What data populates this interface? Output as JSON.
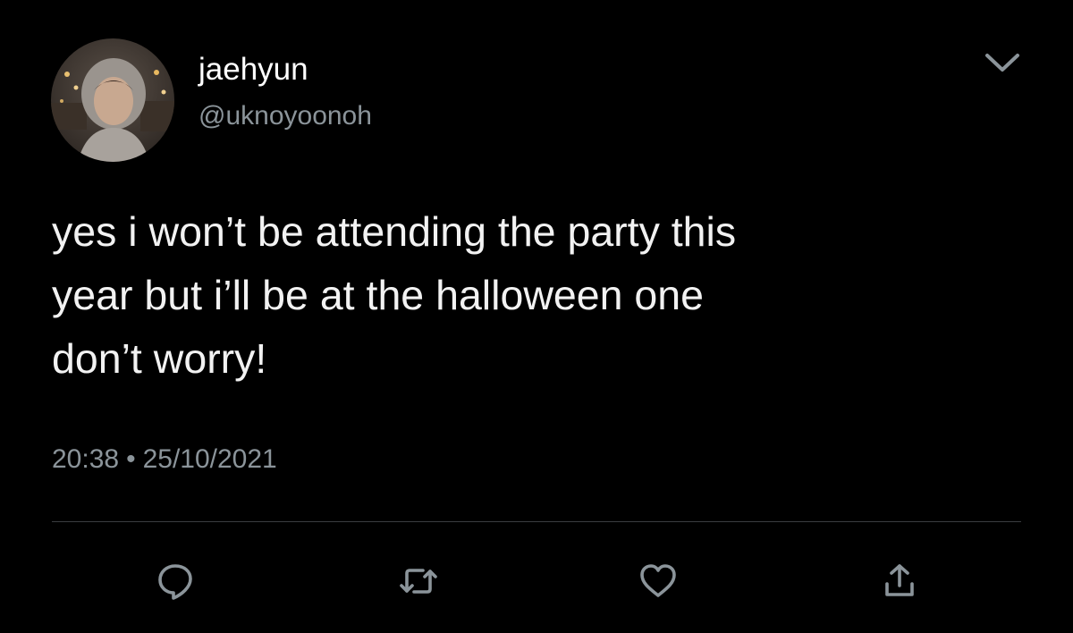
{
  "tweet": {
    "author": {
      "display_name": "jaehyun",
      "handle": "@uknoyoonoh"
    },
    "text_lines": [
      "yes i won’t be attending the party this",
      "year but i’ll be at the halloween one",
      "don’t worry!"
    ],
    "time": "20:38",
    "separator": "•",
    "date": "25/10/2021"
  },
  "icons": {
    "menu": "chevron-down-icon",
    "reply": "reply-icon",
    "retweet": "retweet-icon",
    "like": "heart-icon",
    "share": "share-icon"
  },
  "colors": {
    "background": "#000000",
    "text": "#f2f2f2",
    "secondary_text": "#8b949a",
    "divider": "#3a3d40"
  }
}
